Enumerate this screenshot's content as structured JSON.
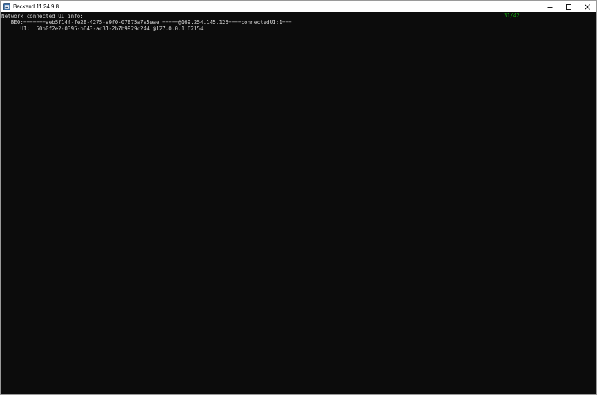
{
  "window": {
    "title": "Backend 11.24.9.8"
  },
  "console": {
    "counter": "31/42",
    "lines": [
      "Network connected UI info:",
      "   BE0:=======aeb5f14f-fe28-4275-a9f0-07875a7a5eae =====@169.254.145.125====connectedUI:1===",
      "      UI:  50b0f2e2-0395-b643-ac31-2b7b9929c244 @127.0.0.1:62154"
    ]
  },
  "colors": {
    "console_background": "#0c0c0c",
    "console_text": "#cccccc",
    "counter_text": "#13a10e",
    "titlebar_background": "#ffffff"
  },
  "icons": {
    "app": "console-app-icon",
    "minimize": "minimize-icon",
    "maximize": "maximize-icon",
    "close": "close-icon"
  }
}
